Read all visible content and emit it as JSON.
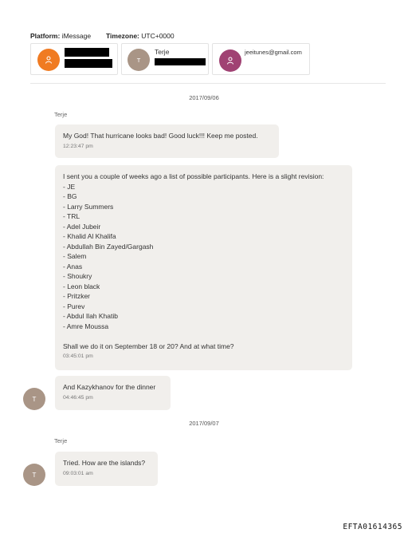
{
  "header": {
    "platform_label": "Platform:",
    "platform_value": "iMessage",
    "timezone_label": "Timezone:",
    "timezone_value": "UTC+0000"
  },
  "participants": [
    {
      "avatar_color": "#f07b22",
      "icon": "person-icon",
      "redacted": true
    },
    {
      "avatar_color": "#a99586",
      "initial": "T",
      "name": "Terje",
      "redacted": true
    },
    {
      "avatar_color": "#a04273",
      "icon": "person-icon",
      "email": "jeeitunes@gmail.com"
    }
  ],
  "conversation": {
    "date1": "2017/09/06",
    "sender1": "Terje",
    "msg1": {
      "text": "My God! That hurricane looks bad! Good luck!!! Keep me posted.",
      "time": "12:23:47 pm"
    },
    "msg2": {
      "lines": [
        "I sent you a couple of weeks ago a list of possible participants. Here is a slight revision:",
        "- JE",
        "- BG",
        "- Larry Summers",
        "- TRL",
        "- Adel Jubeir",
        "- Khalid Al Khalifa",
        "- Abdullah Bin Zayed/Gargash",
        "- Salem",
        "- Anas",
        "- Shoukry",
        "- Leon black",
        "- Pritzker",
        "- Purev",
        "- Abdul Ilah Khatib",
        "- Amre Moussa",
        "",
        "Shall we do it on September 18 or 20? And at what time?"
      ],
      "time": "03:45:01 pm"
    },
    "msg3": {
      "avatar_initial": "T",
      "text": "And Kazykhanov for the dinner",
      "time": "04:46:45 pm"
    },
    "date2": "2017/09/07",
    "sender2": "Terje",
    "msg4": {
      "avatar_initial": "T",
      "text": "Tried. How are the islands?",
      "time": "09:03:01 am"
    }
  },
  "footer": {
    "doc_id": "EFTA01614365"
  }
}
